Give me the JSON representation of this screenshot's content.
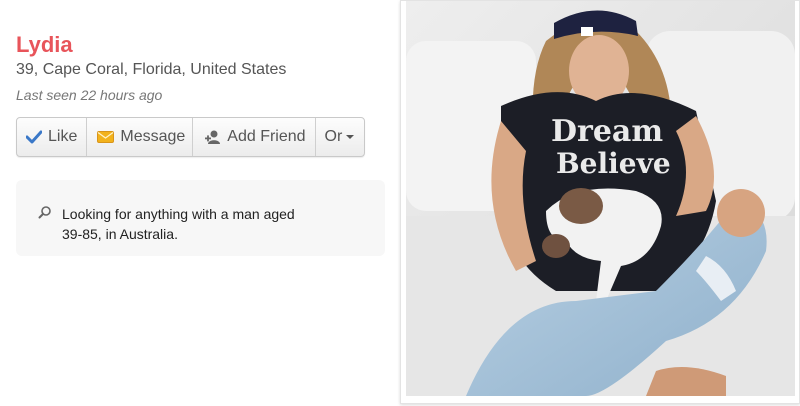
{
  "profile": {
    "name": "Lydia",
    "location": "39, Cape Coral, Florida, United States",
    "last_seen": "Last seen 22 hours ago"
  },
  "actions": {
    "like": {
      "label": "Like",
      "icon": "checkmark-icon"
    },
    "message": {
      "label": "Message",
      "icon": "envelope-icon"
    },
    "add_friend": {
      "label": "Add Friend",
      "icon": "add-person-icon"
    },
    "or": {
      "label": "Or",
      "icon": "caret-down-icon"
    }
  },
  "about": {
    "icon": "search-icon",
    "looking_for": "Looking for anything with a man aged 39-85, in Australia."
  },
  "colors": {
    "name": "#e8545a",
    "like_check": "#3a78c8",
    "message_icon": "#f2b21c"
  }
}
